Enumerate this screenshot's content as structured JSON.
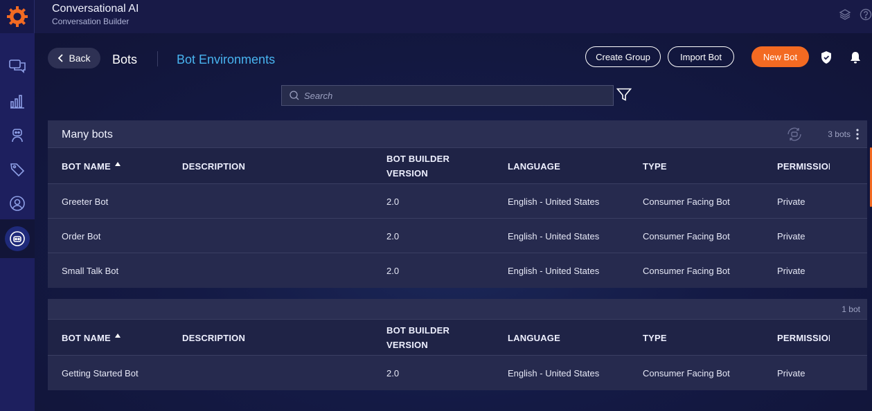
{
  "app": {
    "title": "Conversational AI",
    "subtitle": "Conversation Builder"
  },
  "rail": {
    "icons": [
      "logo-gear-icon",
      "chat-icon",
      "analytics-icon",
      "bot-agent-icon",
      "tag-icon",
      "user-icon",
      "bot-builder-icon"
    ],
    "active": "bot-builder-icon"
  },
  "nav": {
    "back_label": "Back",
    "bots_label": "Bots",
    "environments_label": "Bot Environments"
  },
  "actions": {
    "create_group": "Create Group",
    "import_bot": "Import Bot",
    "new_bot": "New Bot"
  },
  "search": {
    "placeholder": "Search",
    "value": ""
  },
  "columns": [
    "BOT NAME",
    "DESCRIPTION",
    "BOT BUILDER VERSION",
    "LANGUAGE",
    "TYPE",
    "PERMISSION"
  ],
  "groups": [
    {
      "name": "Many bots",
      "count": "3 bots",
      "headers": {
        "name": "BOT NAME",
        "description": "DESCRIPTION",
        "version_1": "BOT BUILDER",
        "version_2": "VERSION",
        "language": "LANGUAGE",
        "type": "TYPE",
        "permission": "PERMISSION"
      },
      "rows": [
        {
          "name": "Greeter Bot",
          "description": "",
          "version": "2.0",
          "language": "English - United States",
          "type": "Consumer Facing Bot",
          "permission": "Private"
        },
        {
          "name": "Order Bot",
          "description": "",
          "version": "2.0",
          "language": "English - United States",
          "type": "Consumer Facing Bot",
          "permission": "Private"
        },
        {
          "name": "Small Talk Bot",
          "description": "",
          "version": "2.0",
          "language": "English - United States",
          "type": "Consumer Facing Bot",
          "permission": "Private"
        }
      ]
    },
    {
      "name": "",
      "count": "1 bot",
      "headers": {
        "name": "BOT NAME",
        "description": "DESCRIPTION",
        "version_1": "BOT BUILDER",
        "version_2": "VERSION",
        "language": "LANGUAGE",
        "type": "TYPE",
        "permission": "PERMISSION"
      },
      "rows": [
        {
          "name": "Getting Started Bot",
          "description": "",
          "version": "2.0",
          "language": "English - United States",
          "type": "Consumer Facing Bot",
          "permission": "Private"
        }
      ]
    }
  ],
  "colors": {
    "accent_orange": "#f36a22",
    "link_blue": "#48b4f0",
    "rail_bg": "#1d1f5e"
  }
}
